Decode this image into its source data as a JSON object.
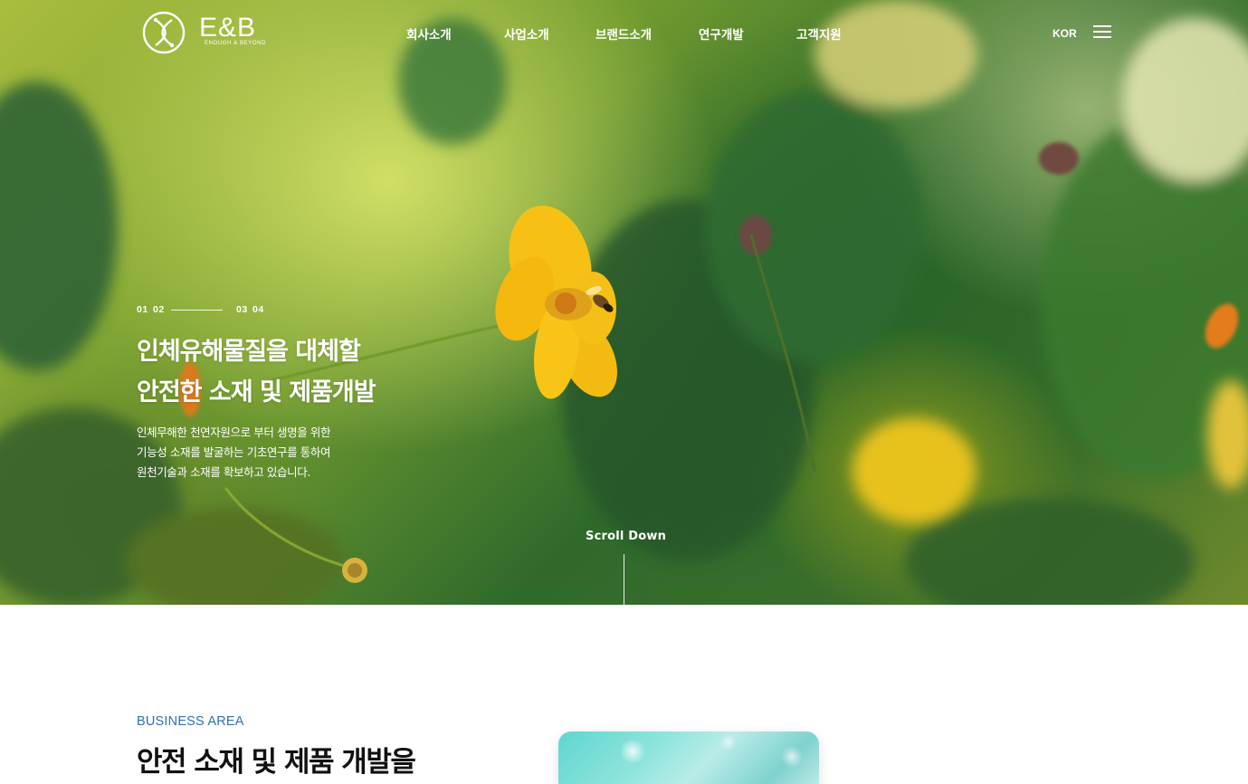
{
  "header": {
    "logo": {
      "name": "E&B",
      "tagline": "ENOUGH & BEYOND"
    },
    "nav": [
      {
        "label": "회사소개"
      },
      {
        "label": "사업소개"
      },
      {
        "label": "브랜드소개"
      },
      {
        "label": "연구개발"
      },
      {
        "label": "고객지원"
      }
    ],
    "language": "KOR",
    "menu_icon": "hamburger-menu-icon"
  },
  "hero": {
    "pager": [
      "01",
      "02",
      "03",
      "04"
    ],
    "headline_line1": "인체유해물질을 대체할",
    "headline_line2": "안전한 소재 및 제품개발",
    "description_line1": "인체무해한 천연자원으로 부터 생명을 위한",
    "description_line2": "기능성 소재를 발굴하는 기초연구를 통하여",
    "description_line3": "원천기술과 소재를 확보하고 있습니다.",
    "scroll_label": "Scroll Down"
  },
  "business": {
    "label": "BUSINESS AREA",
    "title": "안전 소재 및 제품 개발을"
  },
  "colors": {
    "accent_blue": "#2f6fb3",
    "text_dark": "#111111",
    "white": "#ffffff"
  }
}
